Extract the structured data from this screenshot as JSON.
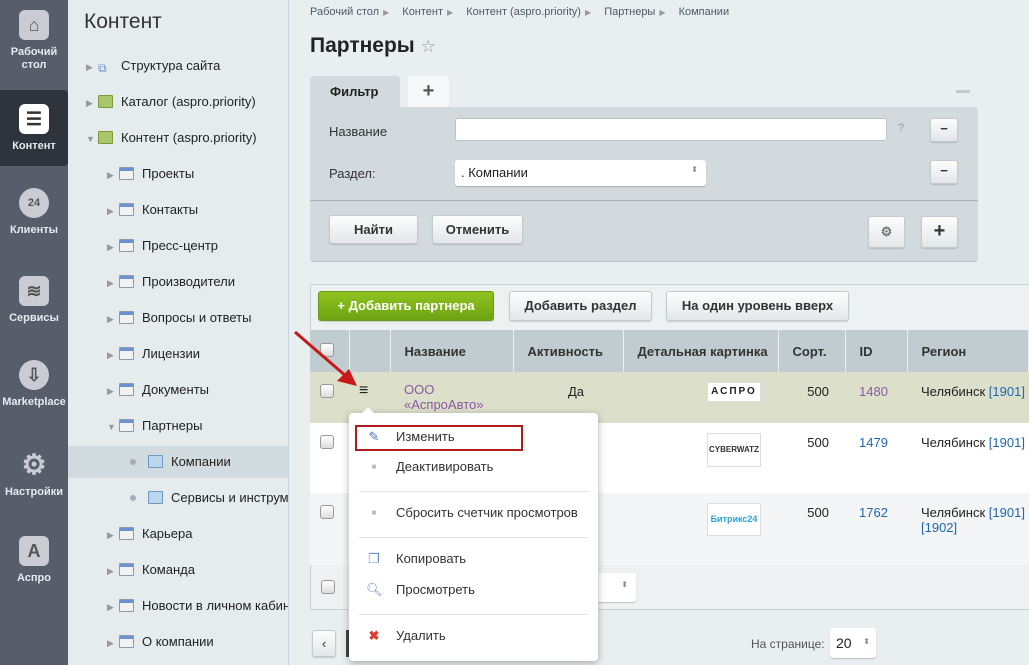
{
  "nav": [
    {
      "label": "Рабочий стол",
      "icon": "home-icon"
    },
    {
      "label": "Контент",
      "icon": "document-icon",
      "active": true
    },
    {
      "label": "Клиенты",
      "icon": "clients-24-icon"
    },
    {
      "label": "Сервисы",
      "icon": "layers-icon"
    },
    {
      "label": "Marketplace",
      "icon": "cloud-download-icon"
    },
    {
      "label": "Настройки",
      "icon": "gear-icon"
    },
    {
      "label": "Аспро",
      "icon": "aspro-a-icon"
    }
  ],
  "tree": {
    "title": "Контент",
    "items": [
      {
        "label": "Структура сайта",
        "level": 0,
        "state": "collapsed",
        "icon": "structure"
      },
      {
        "label": "Каталог (aspro.priority)",
        "level": 0,
        "state": "collapsed",
        "icon": "green"
      },
      {
        "label": "Контент (aspro.priority)",
        "level": 0,
        "state": "expanded",
        "icon": "green"
      },
      {
        "label": "Проекты",
        "level": 1,
        "state": "collapsed",
        "icon": "iblock"
      },
      {
        "label": "Контакты",
        "level": 1,
        "state": "collapsed",
        "icon": "iblock"
      },
      {
        "label": "Пресс-центр",
        "level": 1,
        "state": "collapsed",
        "icon": "iblock"
      },
      {
        "label": "Производители",
        "level": 1,
        "state": "collapsed",
        "icon": "iblock"
      },
      {
        "label": "Вопросы и ответы",
        "level": 1,
        "state": "collapsed",
        "icon": "iblock"
      },
      {
        "label": "Лицензии",
        "level": 1,
        "state": "collapsed",
        "icon": "iblock"
      },
      {
        "label": "Документы",
        "level": 1,
        "state": "collapsed",
        "icon": "iblock"
      },
      {
        "label": "Партнеры",
        "level": 1,
        "state": "expanded",
        "icon": "iblock"
      },
      {
        "label": "Компании",
        "level": 2,
        "state": "leaf",
        "icon": "folder",
        "selected": true
      },
      {
        "label": "Сервисы и инструменты",
        "level": 2,
        "state": "leaf",
        "icon": "folder"
      },
      {
        "label": "Карьера",
        "level": 1,
        "state": "collapsed",
        "icon": "iblock"
      },
      {
        "label": "Команда",
        "level": 1,
        "state": "collapsed",
        "icon": "iblock"
      },
      {
        "label": "Новости в личном кабинете",
        "level": 1,
        "state": "collapsed",
        "icon": "iblock"
      },
      {
        "label": "О компании",
        "level": 1,
        "state": "collapsed",
        "icon": "iblock"
      }
    ]
  },
  "breadcrumb": [
    "Рабочий стол",
    "Контент",
    "Контент (aspro.priority)",
    "Партнеры",
    "Компании"
  ],
  "page_title": "Партнеры",
  "filter": {
    "tab": "Фильтр",
    "add_tab": "+",
    "name_label": "Название",
    "name_value": "",
    "help": "?",
    "section_label": "Раздел:",
    "section_value": ". Компании",
    "find": "Найти",
    "cancel": "Отменить"
  },
  "toolbar": {
    "add": "Добавить партнера",
    "add_section": "Добавить раздел",
    "up": "На один уровень вверх"
  },
  "table": {
    "columns": [
      "Название",
      "Активность",
      "Детальная картинка",
      "Сорт.",
      "ID",
      "Регион"
    ],
    "rows": [
      {
        "name": "ООО «АспроАвто»",
        "active": "Да",
        "logo": "АСПРО",
        "sort": "500",
        "id": "1480",
        "region": "Челябинск",
        "region_ids": [
          "[1901]"
        ]
      },
      {
        "name": "",
        "active": "",
        "logo": "CYBERWATZ",
        "sort": "500",
        "id": "1479",
        "region": "Челябинск",
        "region_ids": [
          "[1901]"
        ]
      },
      {
        "name": "",
        "active": "",
        "logo": "Битрикс24",
        "sort": "500",
        "id": "1762",
        "region": "Челябинск",
        "region_ids": [
          "[1901]",
          "[1902]"
        ]
      }
    ]
  },
  "context_menu": [
    "Изменить",
    "Деактивировать",
    "Сбросить счетчик просмотров",
    "Копировать",
    "Просмотреть",
    "Удалить"
  ],
  "pagination": {
    "per_page_label": "На странице:",
    "per_page": "20"
  }
}
